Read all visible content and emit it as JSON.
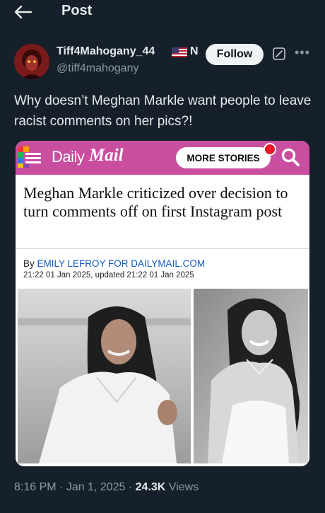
{
  "topbar": {
    "title": "Post"
  },
  "author": {
    "name": "Tiff4Mahogany_44",
    "badge": "N",
    "handle": "@tiff4mahogany",
    "follow_label": "Follow"
  },
  "tweet": {
    "text": "Why doesn’t Meghan Markle want people to leave racist comments on her pics?!"
  },
  "embed": {
    "brand_daily": "Daily",
    "brand_mail": "Mail",
    "more_stories": "MORE STORIES",
    "headline": "Meghan Markle criticized over decision to turn comments off on first Instagram post",
    "byline_prefix": "By ",
    "byline_author": "EMILY LEFROY FOR DAILYMAIL.COM",
    "dateline": "21:22 01 Jan 2025, updated 21:22 01 Jan 2025",
    "header_color": "#c94ea0"
  },
  "meta": {
    "time": "8:16 PM",
    "sep1": " · ",
    "date": "Jan 1, 2025",
    "sep2": " · ",
    "views_count": "24.3K",
    "views_label": " Views"
  },
  "icons": [
    "back-arrow-icon",
    "us-flag-icon",
    "grok-icon",
    "more-icon",
    "menu-icon",
    "search-icon"
  ],
  "colors": {
    "background": "#15202b",
    "text": "#e7e9ea",
    "muted": "#8b98a5",
    "link": "#1559c2"
  }
}
